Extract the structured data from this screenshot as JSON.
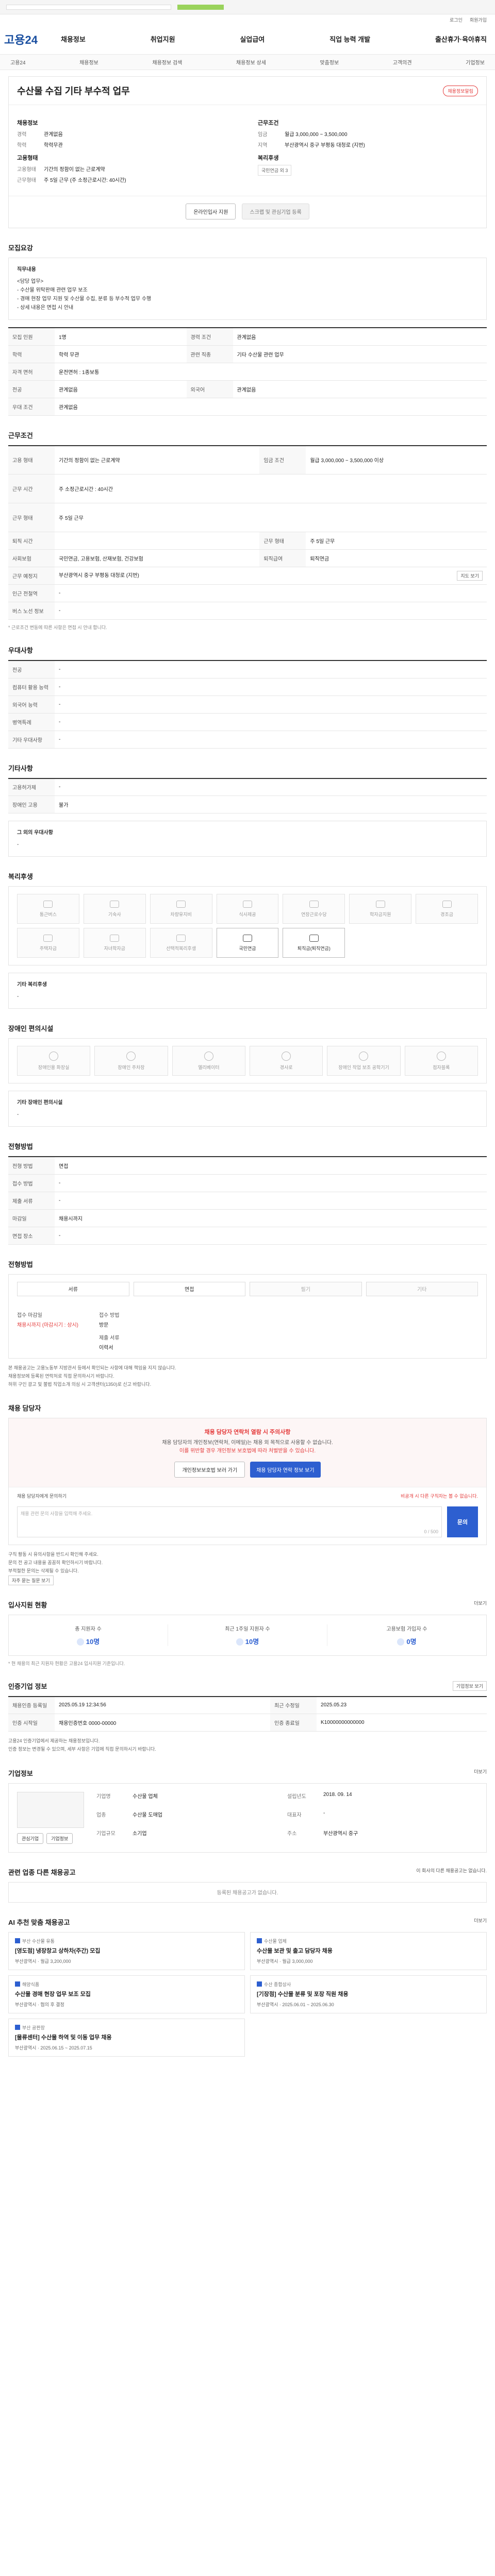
{
  "header": {
    "logo": "고용24",
    "gnb": [
      "채용정보",
      "취업지원",
      "실업급여",
      "직업 능력 개발",
      "출산휴가·육아휴직"
    ],
    "utils": [
      "로그인",
      "회원가입"
    ],
    "subnav": [
      "고용24",
      "채용정보",
      "채용정보 검색",
      "채용정보 상세",
      "맞춤정보",
      "고객의견",
      "기업정보"
    ]
  },
  "title": {
    "text": "수산물 수집 기타 부수적 업무",
    "badge": "채용정보알림"
  },
  "summary": {
    "left_title": "채용정보",
    "left_rows": [
      {
        "k": "경력",
        "v": "관계없음"
      },
      {
        "k": "학력",
        "v": "학력무관"
      }
    ],
    "left_title2": "고용형태",
    "left_rows2": [
      {
        "k": "고용형태",
        "v": "기간의 정함이 없는 근로계약"
      },
      {
        "k": "근무형태",
        "v": "주 5일 근무 (주 소정근로시간: 40시간)"
      }
    ],
    "right_title": "근무조건",
    "right_rows": [
      {
        "k": "임금",
        "v": "월급 3,000,000 ~ 3,500,000"
      },
      {
        "k": "지역",
        "v": "부산광역시 중구 부평동 대청로 (지번)"
      }
    ],
    "right_title2": "복리후생",
    "right_tag": "국민연금 외 3",
    "btn_apply": "온라인입사 지원",
    "btn_scrap": "스크랩 및 관심기업 등록"
  },
  "recruit": {
    "section": "모집요강",
    "title": "직무내용",
    "lines": [
      "<담당 업무>",
      "- 수산물 위탁판매 관련 업무 보조",
      "- 경매 현장 업무 지원 및 수산물 수집, 분류 등 부수적 업무 수행",
      "- 상세 내용은 면접 시 안내"
    ],
    "rows": [
      {
        "k1": "모집 인원",
        "v1": "1명",
        "k2": "경력 조건",
        "v2": "관계없음"
      },
      {
        "k1": "학력",
        "v1": "학력 무관",
        "k2": "관련 직종",
        "v2": "기타 수산물 관련 업무"
      },
      {
        "k1": "자격 면허",
        "v1": "운전면허 : 1종보통",
        "k2": "",
        "v2": ""
      },
      {
        "k1": "전공",
        "v1": "관계없음",
        "k2": "외국어",
        "v2": "관계없음"
      },
      {
        "k1": "우대 조건",
        "v1": "관계없음",
        "k2": "",
        "v2": ""
      }
    ]
  },
  "work": {
    "section": "근무조건",
    "rows": [
      {
        "k1": "고용 형태",
        "v1": "기간의 정함이 없는 근로계약",
        "k2": "임금 조건",
        "v2": "월급 3,000,000 ~ 3,500,000 이상"
      },
      {
        "k1": "근무 시간",
        "v1": "주 소정근로시간 : 40시간",
        "k2": "",
        "v2": ""
      },
      {
        "k1": "근무 형태",
        "v1": "주 5일 근무",
        "k2": "",
        "v2": ""
      },
      {
        "k1": "퇴직 시간",
        "v1": "",
        "k2": "근무 형태",
        "v2": "주 5일 근무"
      },
      {
        "k1": "사회보험",
        "v1": "국민연금, 고용보험, 산재보험, 건강보험",
        "k2": "퇴직급여",
        "v2": "퇴직연금"
      },
      {
        "k1": "근무 예정지",
        "v1": "부산광역시 중구 부평동 대청로 (지번)",
        "k2": "",
        "v2": ""
      },
      {
        "k1": "인근 전철역",
        "v1": "-",
        "k2": "",
        "v2": ""
      },
      {
        "k1": "버스 노선 정보",
        "v1": "-",
        "k2": "",
        "v2": ""
      }
    ],
    "map_btn": "지도 보기",
    "note": "* 근로조건 변동에 따른 사항은 면접 시 안내 합니다."
  },
  "prefer": {
    "section": "우대사항",
    "rows": [
      {
        "k": "전공",
        "v": "-"
      },
      {
        "k": "컴퓨터 활용 능력",
        "v": "-"
      },
      {
        "k": "외국어 능력",
        "v": "-"
      },
      {
        "k": "병역특례",
        "v": "-"
      },
      {
        "k": "기타 우대사항",
        "v": "-"
      }
    ]
  },
  "other": {
    "section": "기타사항",
    "rows": [
      {
        "k": "고용허가제",
        "v": "-"
      },
      {
        "k": "장애인 고용",
        "v": "불가"
      }
    ],
    "extra_title": "그 외의 우대사항",
    "extra_value": "-"
  },
  "welfare": {
    "section": "복리후생",
    "items": [
      {
        "label": "통근버스",
        "on": false
      },
      {
        "label": "기숙사",
        "on": false
      },
      {
        "label": "차량유지비",
        "on": false
      },
      {
        "label": "식사제공",
        "on": false
      },
      {
        "label": "연장근로수당",
        "on": false
      },
      {
        "label": "학자금지원",
        "on": false
      },
      {
        "label": "경조금",
        "on": false
      },
      {
        "label": "주택자금",
        "on": false
      },
      {
        "label": "자녀학자금",
        "on": false
      },
      {
        "label": "선택적복리후생",
        "on": false
      },
      {
        "label": "국민연금",
        "on": true
      },
      {
        "label": "퇴직금(퇴직연금)",
        "on": true
      }
    ],
    "extra_title": "기타 복리후생",
    "extra_value": "-"
  },
  "access": {
    "section": "장애인 편의시설",
    "items": [
      "장애인용 화장실",
      "장애인 주차장",
      "엘리베이터",
      "경사로",
      "장애인 작업 보조 공학기기",
      "점자블록"
    ],
    "extra_title": "기타 장애인 편의시설",
    "extra_value": "-"
  },
  "process": {
    "section": "전형방법",
    "rows": [
      {
        "k1": "전형 방법",
        "v1": "면접",
        "k2": "",
        "v2": ""
      },
      {
        "k1": "접수 방법",
        "v1": "-",
        "k2": "",
        "v2": ""
      },
      {
        "k1": "제출 서류",
        "v1": "-",
        "k2": "",
        "v2": ""
      },
      {
        "k1": "마감일",
        "v1": "채용시까지",
        "k2": "",
        "v2": ""
      },
      {
        "k1": "면접 장소",
        "v1": "-",
        "k2": "",
        "v2": ""
      }
    ]
  },
  "apply": {
    "section": "전형방법",
    "methods": [
      {
        "label": "서류",
        "on": true
      },
      {
        "label": "면접",
        "on": true
      },
      {
        "label": "필기",
        "on": false
      },
      {
        "label": "기타",
        "on": false
      }
    ],
    "docs_k": "접수 마감일",
    "docs_v": "채용시까지 (마감시기 : 상시)",
    "docs_k2": "접수 방법",
    "docs_v2": "방문",
    "docs_k3": "제출 서류",
    "docs_v3": "이력서",
    "bullets": [
      "본 채용공고는 고용노동부 지방관서 등에서 확인되는 사항에 대해 책임을 지지 않습니다.",
      "채용정보에 등록된 연락처로 직접 문의하시기 바랍니다.",
      "허위 구인 광고 및 불법 직업소개 의심 시 고객센터(1350)로 신고 바랍니다."
    ]
  },
  "manager": {
    "section": "채용 담당자",
    "t1": "채용 담당자 연락처 열람 시 주의사항",
    "t2a": "채용 담당자의 개인정보(연락처, 이메일)는 채용 외 목적으로 사용할 수 없습니다.",
    "t2b": "이를 위반할 경우 개인정보 보호법에 따라 처벌받을 수 있습니다.",
    "btn1": "개인정보보호법 보러 가기",
    "btn2": "채용 담당자 연락 정보 보기",
    "ask_label": "채용 담당자에게 문의하기",
    "ask_note": "비공개 시 다른 구직자는 볼 수 없습니다.",
    "ask_placeholder": "채용 관련 문의 사항을 입력해 주세요.",
    "ask_counter": "0 / 500",
    "ask_btn": "문의",
    "bullets": [
      "구직 활동 시 유의사항을 반드시 확인해 주세요.",
      "문의 전 공고 내용을 꼼꼼히 확인하시기 바랍니다.",
      "부적절한 문의는 삭제될 수 있습니다."
    ],
    "btn_faq": "자주 묻는 질문 보기"
  },
  "stats": {
    "section": "입사지원 현황",
    "more": "더보기",
    "items": [
      {
        "label": "총 지원자 수",
        "value": "10명"
      },
      {
        "label": "최근 1주일 지원자 수",
        "value": "10명"
      },
      {
        "label": "고용보험 가입자 수",
        "value": "0명"
      }
    ],
    "note": "* 현 채용의 최근 지원자 현황은 고용24 입사지원 기준입니다."
  },
  "info": {
    "section": "인증기업 정보",
    "btn": "기업정보 보기",
    "rows": [
      {
        "k1": "채용인증 등록일",
        "v1": "2025.05.19 12:34:56",
        "k2": "최근 수정일",
        "v2": "2025.05.23"
      },
      {
        "k1": "인증 시작일",
        "v1": "채용인증번호 0000-00000",
        "k2": "인증 종료일",
        "v2": "K10000000000000"
      }
    ],
    "notes": [
      "고용24 인증기업에서 제공하는 채용정보입니다.",
      "인증 정보는 변경될 수 있으며, 세부 사항은 기업에 직접 문의하시기 바랍니다."
    ]
  },
  "company": {
    "section": "기업정보",
    "more": "더보기",
    "btn1": "관심기업",
    "btn2": "기업정보",
    "rows": [
      {
        "k": "기업명",
        "v": "수산물 업체"
      },
      {
        "k": "업종",
        "v": "수산물 도매업"
      },
      {
        "k": "기업규모",
        "v": "소기업"
      },
      {
        "k": "대표자",
        "v": "-"
      },
      {
        "k": "설립년도",
        "v": "2018. 09. 14"
      },
      {
        "k": "주소",
        "v": "부산광역시 중구"
      }
    ]
  },
  "similar": {
    "section": "관련 업종 다른 채용공고",
    "note": "이 회사의 다른 채용공고는 없습니다.",
    "empty": "등록된 채용공고가 없습니다."
  },
  "recommend": {
    "section": "AI 추천 맞춤 채용공고",
    "more": "더보기",
    "items": [
      {
        "co": "부산 수산물 유통",
        "title": "[영도점] 냉장창고 상하차(주간) 모집",
        "meta": "부산광역시 · 월급 3,200,000"
      },
      {
        "co": "수산물 업체",
        "title": "수산물 보관 및 출고 담당자 채용",
        "meta": "부산광역시 · 월급 3,000,000"
      },
      {
        "co": "해양식품",
        "title": "수산물 경매 현장 업무 보조 모집",
        "meta": "부산광역시 · 협의 후 결정"
      },
      {
        "co": "수산 종합상사",
        "title": "[기장점] 수산물 분류 및 포장 직원 채용",
        "meta": "부산광역시 · 2025.06.01 ~ 2025.06.30"
      },
      {
        "co": "부산 공판장",
        "title": "[물류센터] 수산물 하역 및 이동 업무 채용",
        "meta": "부산광역시 · 2025.06.15 ~ 2025.07.15"
      },
      {
        "co": "",
        "title": "",
        "meta": ""
      }
    ]
  }
}
